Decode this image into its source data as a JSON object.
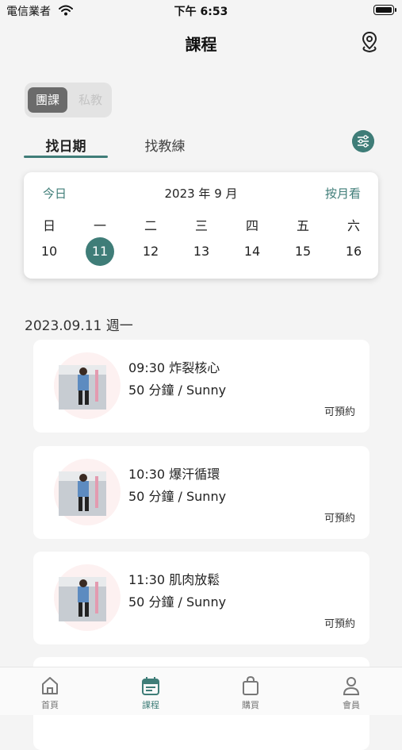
{
  "status_bar": {
    "carrier": "電信業者",
    "time": "下午 6:53"
  },
  "header": {
    "title": "課程",
    "location_icon": "location-pin-icon"
  },
  "segment": {
    "options": [
      "團課",
      "私教"
    ],
    "selected": "團課"
  },
  "tabs": {
    "date_label": "找日期",
    "coach_label": "找教練",
    "filter_icon": "sliders-icon"
  },
  "calendar": {
    "today_label": "今日",
    "month_label": "2023 年 9 月",
    "by_month_label": "按月看",
    "weekdays": [
      "日",
      "一",
      "二",
      "三",
      "四",
      "五",
      "六"
    ],
    "days": [
      "10",
      "11",
      "12",
      "13",
      "14",
      "15",
      "16"
    ],
    "selected_day": "11"
  },
  "date_heading": "2023.09.11 週一",
  "classes": [
    {
      "title": "09:30 炸裂核心",
      "details": "50 分鐘 / Sunny",
      "status": "可預約"
    },
    {
      "title": "10:30 爆汗循環",
      "details": "50 分鐘 / Sunny",
      "status": "可預約"
    },
    {
      "title": "11:30 肌肉放鬆",
      "details": "50 分鐘 / Sunny",
      "status": "可預約"
    }
  ],
  "tabbar": {
    "items": [
      {
        "label": "首頁",
        "icon": "home-icon"
      },
      {
        "label": "課程",
        "icon": "calendar-icon"
      },
      {
        "label": "購買",
        "icon": "shopping-bag-icon"
      },
      {
        "label": "會員",
        "icon": "user-icon"
      }
    ],
    "active": "課程"
  },
  "colors": {
    "accent": "#3f7d78",
    "background": "#f4f4f4",
    "card": "#ffffff"
  }
}
